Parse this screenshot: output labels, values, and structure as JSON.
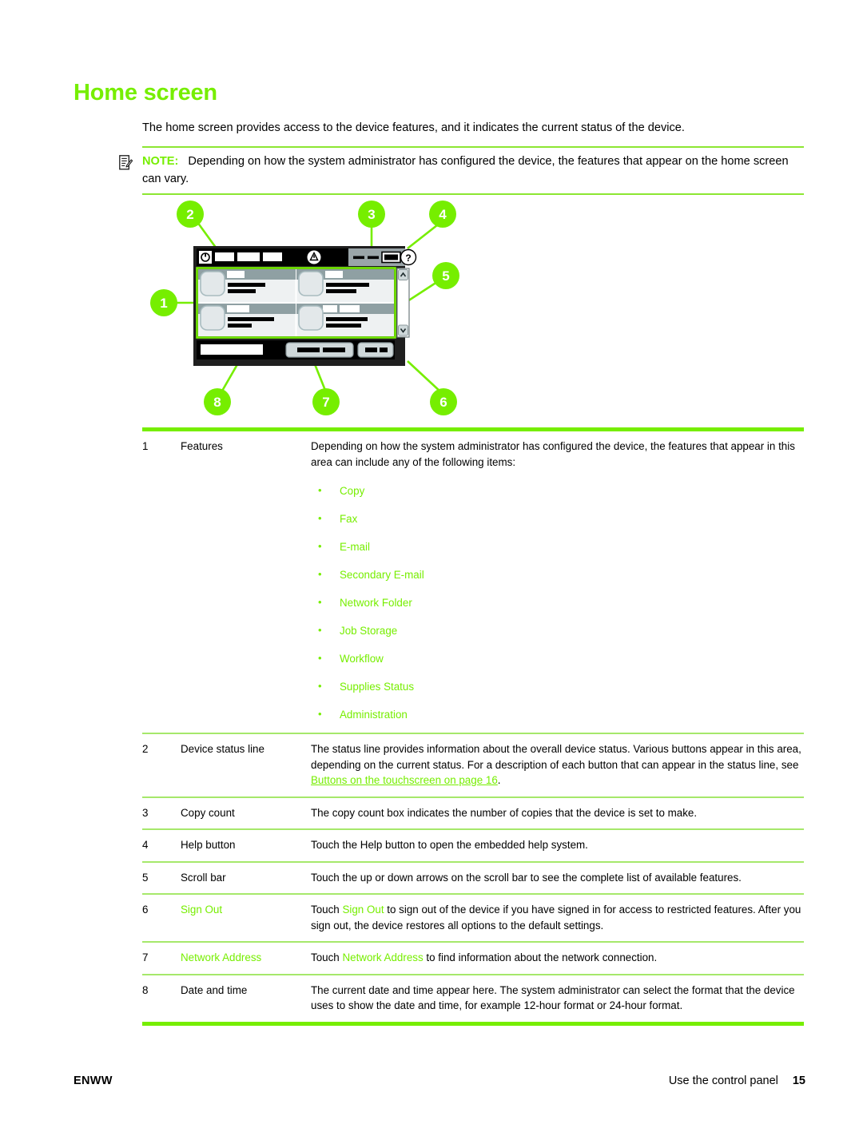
{
  "heading": "Home screen",
  "intro": "The home screen provides access to the device features, and it indicates the current status of the device.",
  "note": {
    "label": "NOTE:",
    "text": "Depending on how the system administrator has configured the device, the features that appear on the home screen can vary."
  },
  "figure": {
    "alt": "Control panel home screen illustration with numbered callouts",
    "callouts": [
      "1",
      "2",
      "3",
      "4",
      "5",
      "6",
      "7",
      "8"
    ]
  },
  "table": {
    "rows": [
      {
        "num": "1",
        "term": "Features",
        "desc": "Depending on how the system administrator has configured the device, the features that appear in this area can include any of the following items:",
        "bullets": [
          "Copy",
          "Fax",
          "E-mail",
          "Secondary E-mail",
          "Network Folder",
          "Job Storage",
          "Workflow",
          "Supplies Status",
          "Administration"
        ]
      },
      {
        "num": "2",
        "term": "Device status line",
        "desc_pre": "The status line provides information about the overall device status. Various buttons appear in this area, depending on the current status. For a description of each button that can appear in the status line, see ",
        "link": "Buttons on the touchscreen on page 16",
        "desc_post": "."
      },
      {
        "num": "3",
        "term": "Copy count",
        "desc": "The copy count box indicates the number of copies that the device is set to make."
      },
      {
        "num": "4",
        "term": "Help button",
        "desc": "Touch the Help button to open the embedded help system."
      },
      {
        "num": "5",
        "term": "Scroll bar",
        "desc": "Touch the up or down arrows on the scroll bar to see the complete list of available features."
      },
      {
        "num": "6",
        "term": "Sign Out",
        "term_green": true,
        "desc_pre": "Touch ",
        "green_span": "Sign Out",
        "desc_post": " to sign out of the device if you have signed in for access to restricted features. After you sign out, the device restores all options to the default settings."
      },
      {
        "num": "7",
        "term": "Network Address",
        "term_green": true,
        "desc_pre": "Touch ",
        "green_span": "Network Address",
        "desc_post": " to find information about the network connection."
      },
      {
        "num": "8",
        "term": "Date and time",
        "desc": "The current date and time appear here. The system administrator can select the format that the device uses to show the date and time, for example 12-hour format or 24-hour format."
      }
    ]
  },
  "footer": {
    "left": "ENWW",
    "right": "Use the control panel",
    "page": "15"
  },
  "colors": {
    "accent_green": "#76EE00",
    "rule_green": "#A6E86B",
    "text_black": "#000000"
  }
}
